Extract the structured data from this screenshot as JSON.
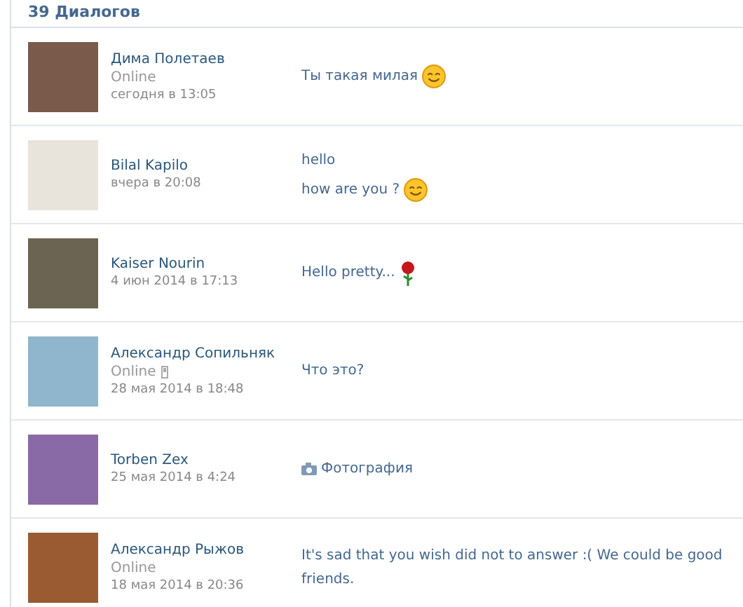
{
  "header": {
    "title": "39 Диалогов"
  },
  "dialogs": [
    {
      "name": "Дима Полетаев",
      "status": "Online",
      "mobile": false,
      "time": "сегодня в 13:05",
      "message": {
        "kind": "text",
        "lines": [
          {
            "text": "Ты такая милая",
            "kind": "smile"
          }
        ]
      }
    },
    {
      "name": "Bilal Kapilo",
      "mobile": false,
      "time": "вчера в 20:08",
      "message": {
        "kind": "text",
        "lines": [
          {
            "text": "hello",
            "kind": "plain"
          },
          {
            "text": "how are you ?",
            "kind": "smile"
          }
        ]
      }
    },
    {
      "name": "Kaiser Nourin",
      "mobile": false,
      "time": "4 июн 2014 в 17:13",
      "message": {
        "kind": "text",
        "lines": [
          {
            "text": "Hello pretty...",
            "kind": "rose"
          }
        ]
      }
    },
    {
      "name": "Александр Сопильняк",
      "status": "Online",
      "mobile": true,
      "time": "28 мая 2014 в 18:48",
      "message": {
        "kind": "text",
        "lines": [
          {
            "text": "Что это?",
            "kind": "plain"
          }
        ]
      }
    },
    {
      "name": "Torben Zex",
      "mobile": false,
      "time": "25 мая 2014 в 4:24",
      "message": {
        "kind": "photo",
        "lines": [
          {
            "text": "Фотография",
            "kind": "plain"
          }
        ]
      }
    },
    {
      "name": "Александр Рыжов",
      "status": "Online",
      "mobile": false,
      "time": "18 мая 2014 в 20:36",
      "message": {
        "kind": "text",
        "lines": [
          {
            "text": "It's sad that you wish did not to answer :( We could be good friends.",
            "kind": "plain"
          }
        ]
      }
    }
  ]
}
